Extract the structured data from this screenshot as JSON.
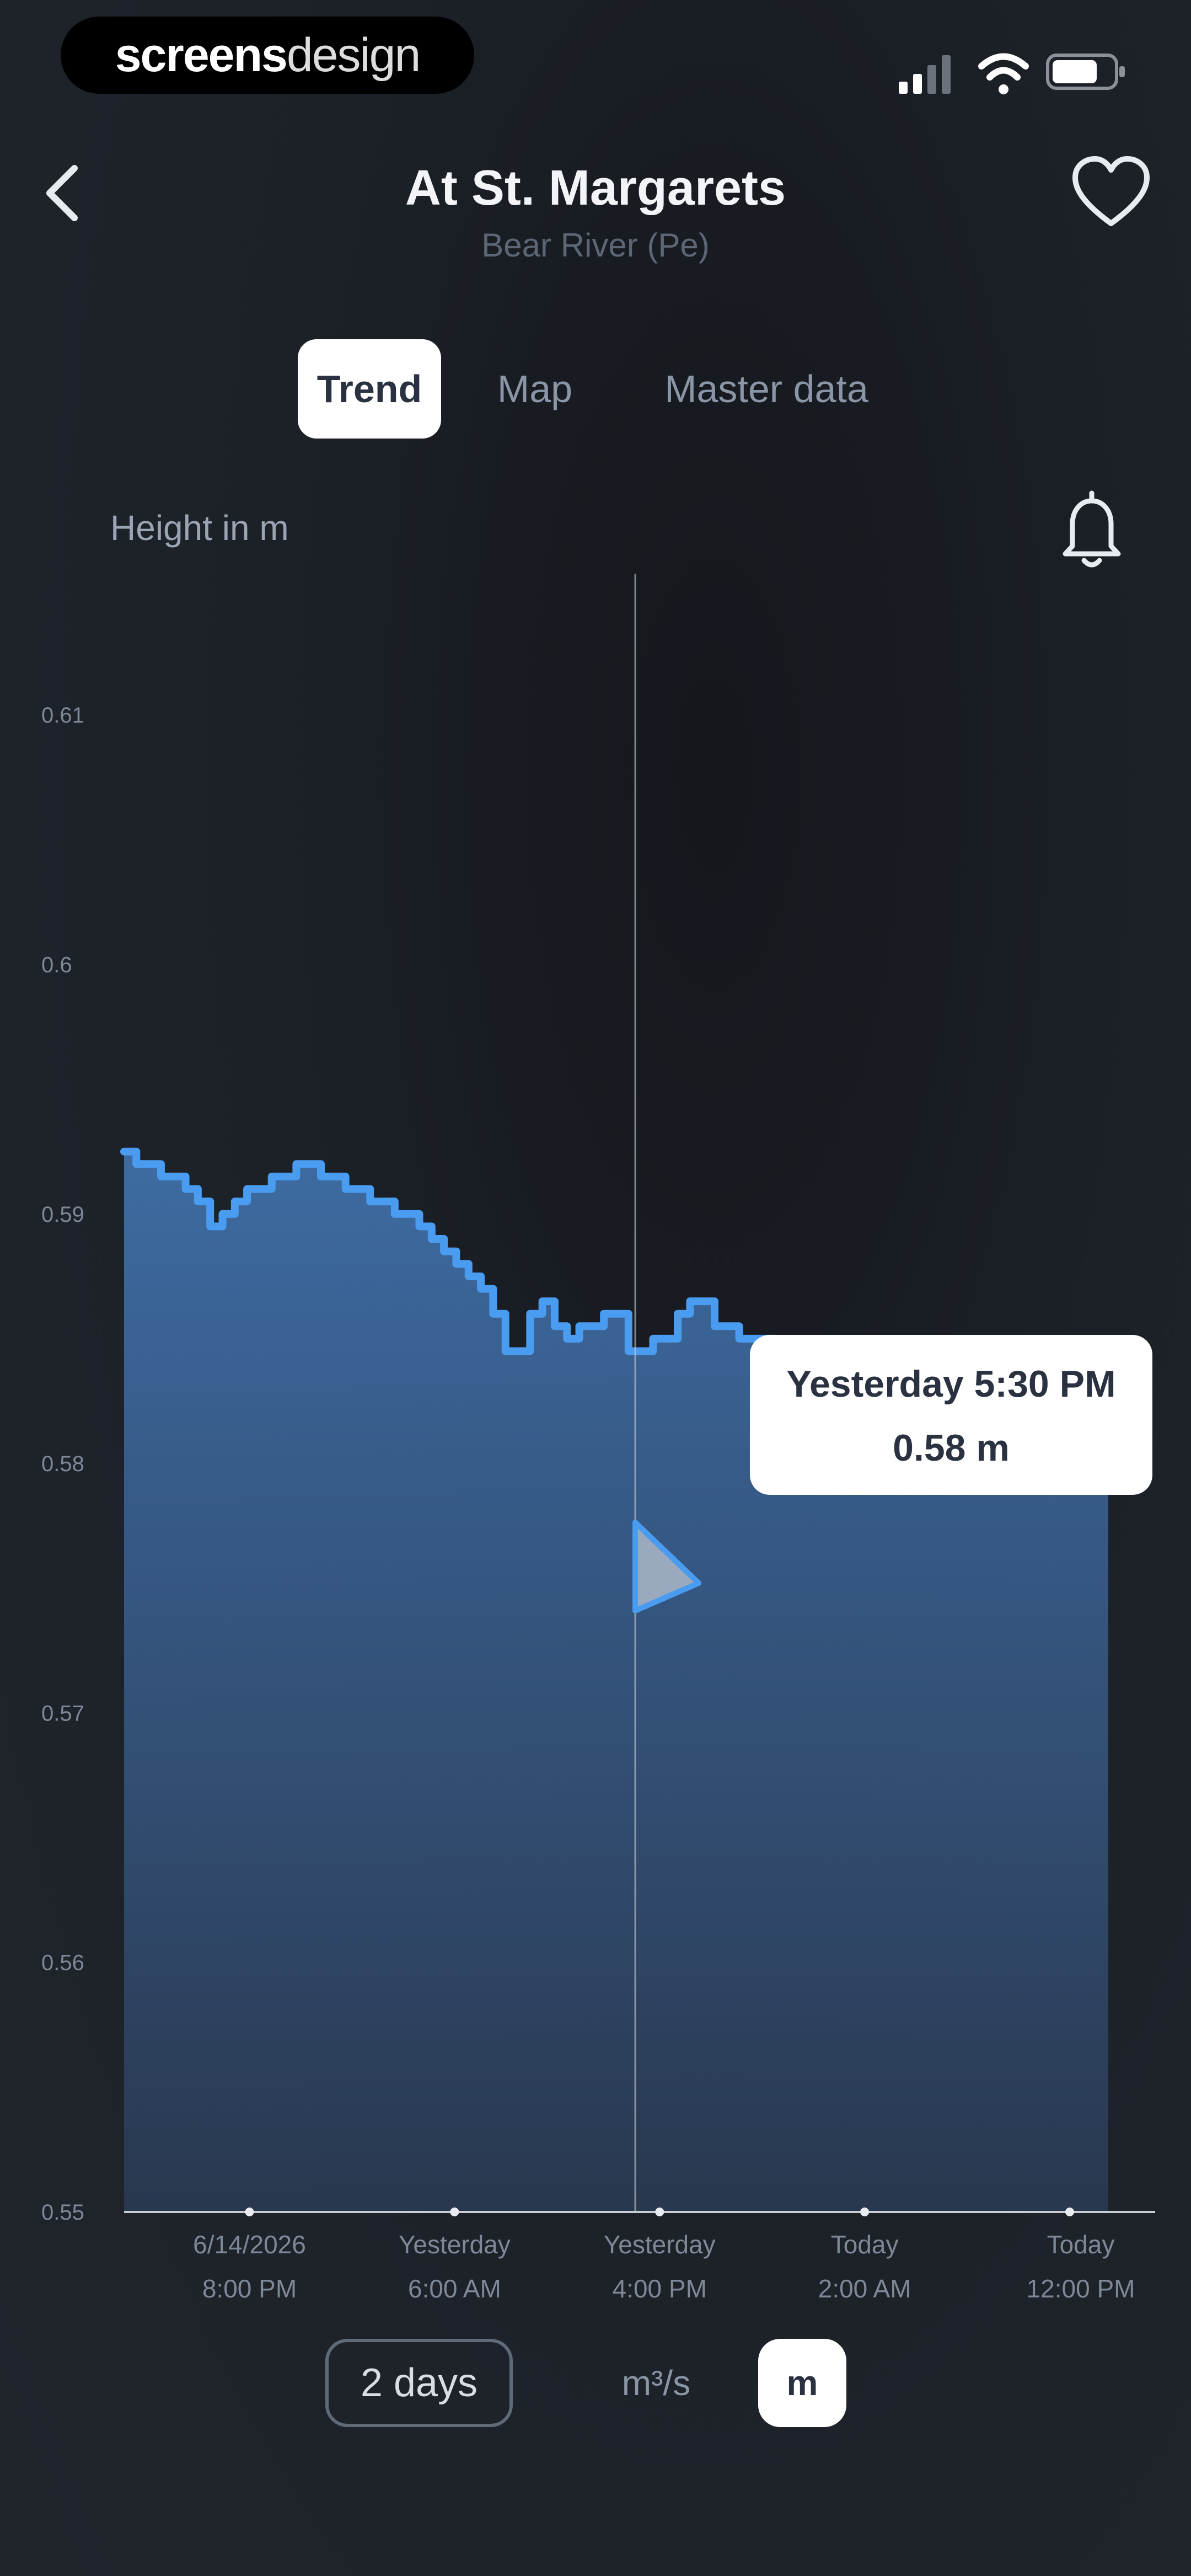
{
  "status": {
    "logo_bold": "screens",
    "logo_light": "design"
  },
  "header": {
    "title": "At St. Margarets",
    "subtitle": "Bear River (Pe)"
  },
  "tabs": [
    {
      "label": "Trend",
      "active": true
    },
    {
      "label": "Map",
      "active": false
    },
    {
      "label": "Master data",
      "active": false
    }
  ],
  "chart_header": {
    "ylabel": "Height in m"
  },
  "icons": {
    "back": "chevron-left-icon",
    "favorite": "heart-icon",
    "bell": "bell-icon",
    "signal": "signal-icon",
    "wifi": "wifi-icon",
    "battery": "battery-icon"
  },
  "colors": {
    "line": "#4a9cf0",
    "fill_top": "#3f6fa8",
    "fill_bottom": "#2a3a52",
    "background": "#1c2128"
  },
  "chart_data": {
    "type": "area",
    "title": "",
    "xlabel": "",
    "ylabel": "Height in m",
    "unit": "m",
    "ylim": [
      0.55,
      0.615
    ],
    "y_ticks": [
      "0.61",
      "0.6",
      "0.59",
      "0.58",
      "0.57",
      "0.56",
      "0.55"
    ],
    "x_ticks": [
      {
        "line1": "6/14/2026",
        "line2": "8:00 PM",
        "hour": 8
      },
      {
        "line1": "Yesterday",
        "line2": "6:00 AM",
        "hour": 18
      },
      {
        "line1": "Yesterday",
        "line2": "4:00 PM",
        "hour": 28
      },
      {
        "line1": "Today",
        "line2": "2:00 AM",
        "hour": 38
      },
      {
        "line1": "Today",
        "line2": "12:00 PM",
        "hour": 48
      }
    ],
    "x_range_hours": [
      0,
      48
    ],
    "series": [
      {
        "x": [
          0.0,
          0.6,
          1.2,
          1.8,
          2.4,
          3.0,
          3.6,
          4.2,
          4.8,
          5.4,
          6.0,
          6.6,
          7.2,
          7.8,
          8.4,
          9.0,
          9.6,
          10.2,
          10.8,
          11.4,
          12.0,
          12.6,
          13.2,
          13.8,
          14.4,
          15.0,
          15.6,
          16.2,
          16.8,
          17.4,
          18.0,
          18.6,
          19.2,
          19.8,
          20.4,
          21.0,
          21.6,
          22.2,
          22.8,
          23.4,
          24.0,
          24.6,
          25.2,
          25.8,
          26.4,
          27.0,
          27.6,
          28.2,
          28.8,
          29.4,
          30.0,
          30.6,
          31.2,
          31.8,
          32.4,
          33.0,
          33.6,
          34.2,
          34.8,
          35.4,
          36.0,
          36.6,
          37.2,
          37.8,
          38.4,
          39.0,
          39.6,
          40.2,
          40.8,
          41.4,
          42.0,
          42.6,
          43.2,
          43.8,
          44.4,
          45.0,
          45.6,
          46.2,
          46.8,
          47.4,
          48.0
        ],
        "y": [
          0.5925,
          0.592,
          0.592,
          0.5915,
          0.5915,
          0.591,
          0.5905,
          0.5895,
          0.59,
          0.5905,
          0.591,
          0.591,
          0.5915,
          0.5915,
          0.592,
          0.592,
          0.5915,
          0.5915,
          0.591,
          0.591,
          0.5905,
          0.5905,
          0.59,
          0.59,
          0.5895,
          0.589,
          0.5885,
          0.588,
          0.5875,
          0.587,
          0.586,
          0.5845,
          0.5845,
          0.586,
          0.5865,
          0.5855,
          0.585,
          0.5855,
          0.5855,
          0.586,
          0.586,
          0.5845,
          0.5845,
          0.585,
          0.585,
          0.586,
          0.5865,
          0.5865,
          0.5855,
          0.5855,
          0.585,
          0.585,
          0.585,
          0.5845,
          0.5845,
          0.5845,
          0.5845,
          0.5845,
          0.584,
          0.584,
          0.584,
          0.5835,
          0.5835,
          0.5835,
          0.583,
          0.583,
          0.583,
          0.583,
          0.5825,
          0.5825,
          0.5825,
          0.582,
          0.582,
          0.582,
          0.582,
          0.5815,
          0.5815,
          0.5815,
          0.581,
          0.581,
          0.581
        ]
      }
    ],
    "tooltip": {
      "time": "Yesterday 5:30 PM",
      "value": "0.58 m",
      "hour": 29.5
    },
    "grid": false,
    "legend": "none"
  },
  "controls": {
    "range_label": "2 days",
    "units": [
      {
        "label": "m³/s",
        "active": false
      },
      {
        "label": "m",
        "active": true
      }
    ]
  }
}
